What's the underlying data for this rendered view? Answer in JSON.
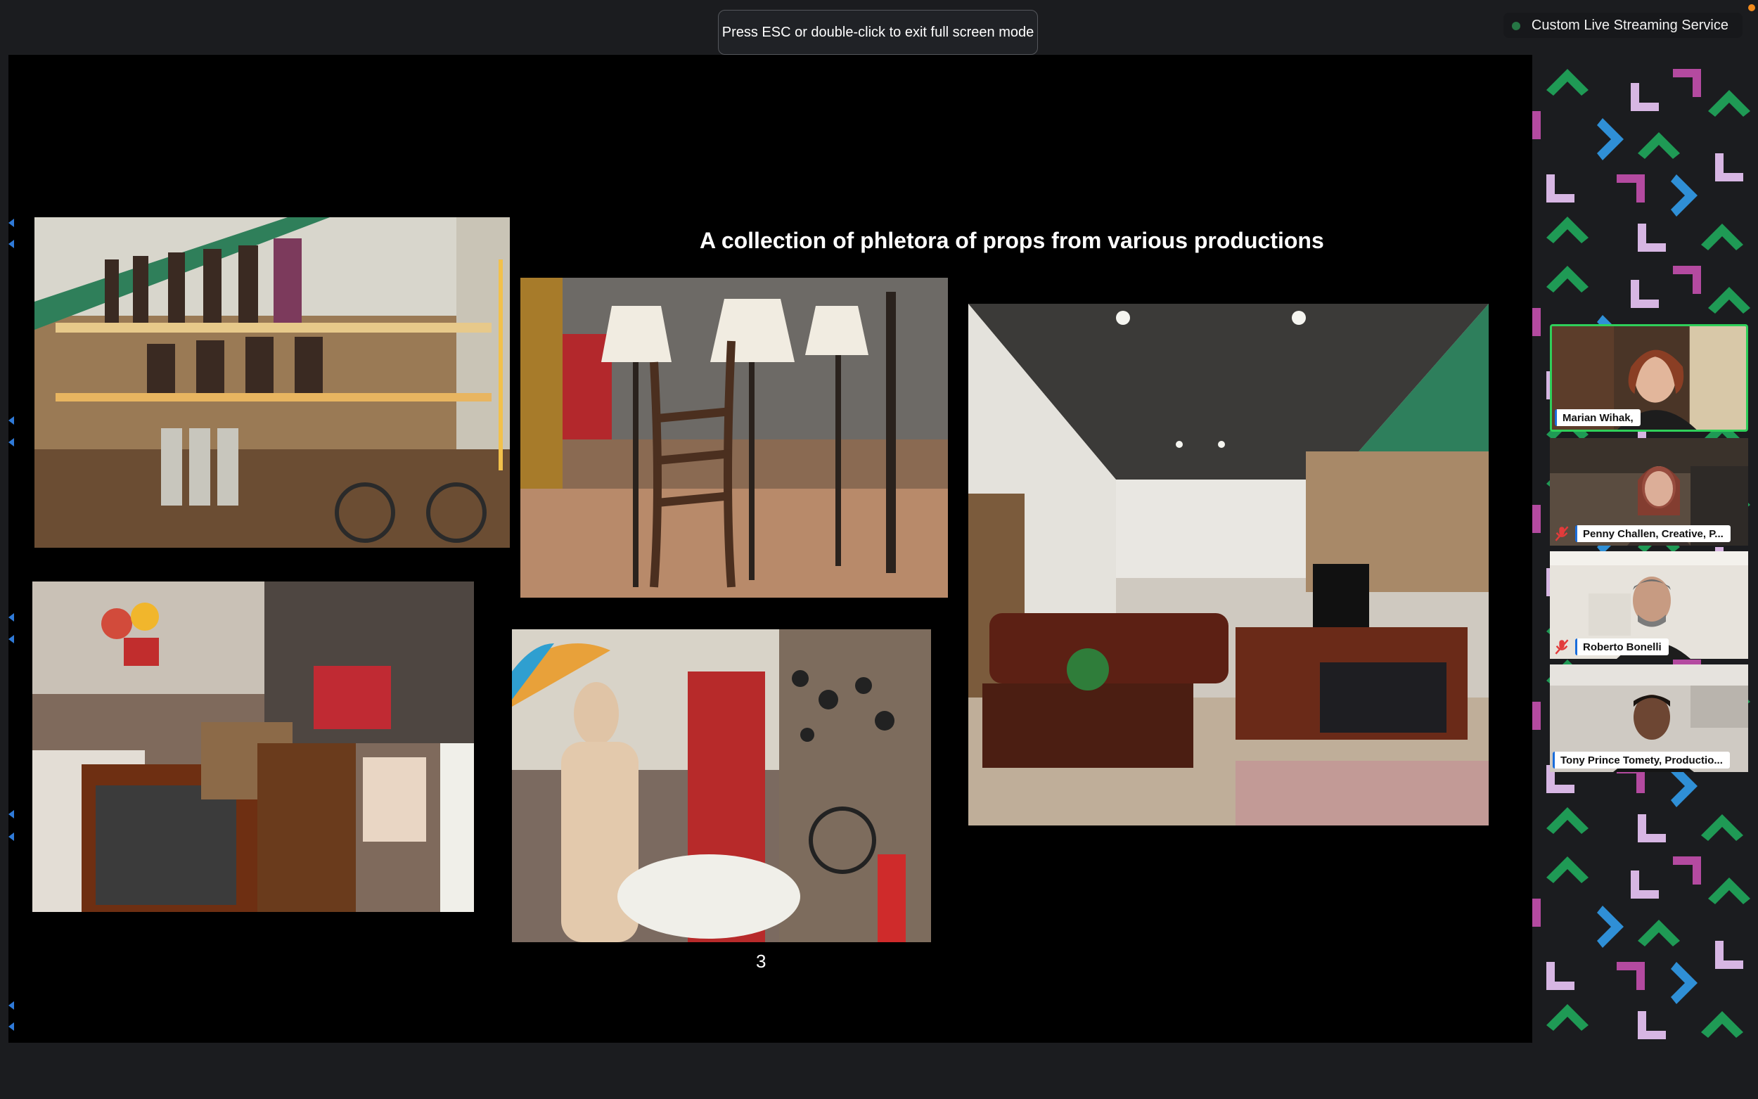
{
  "fullscreen_hint": "Press ESC or double-click to exit full screen mode",
  "stream_label": "Custom Live Streaming Service",
  "slide": {
    "title": "A collection of phletora of props from various productions",
    "page_number": "3"
  },
  "participants": [
    {
      "name": "Marian Wihak,",
      "active_speaker": true,
      "muted": false
    },
    {
      "name": "Penny Challen, Creative, P...",
      "active_speaker": false,
      "muted": true
    },
    {
      "name": "Roberto Bonelli",
      "active_speaker": false,
      "muted": true
    },
    {
      "name": "Tony Prince Tomety, Productio...",
      "active_speaker": false,
      "muted": false
    }
  ],
  "colors": {
    "active_speaker_border": "#2fcf5a",
    "pattern_green": "#1f9a55",
    "pattern_blue": "#2f8fd6",
    "pattern_pink": "#b44aa0",
    "pattern_lilac": "#d7b6e3"
  },
  "icons": {
    "mute": "mic-muted-icon",
    "stream": "live-stream-icon"
  }
}
